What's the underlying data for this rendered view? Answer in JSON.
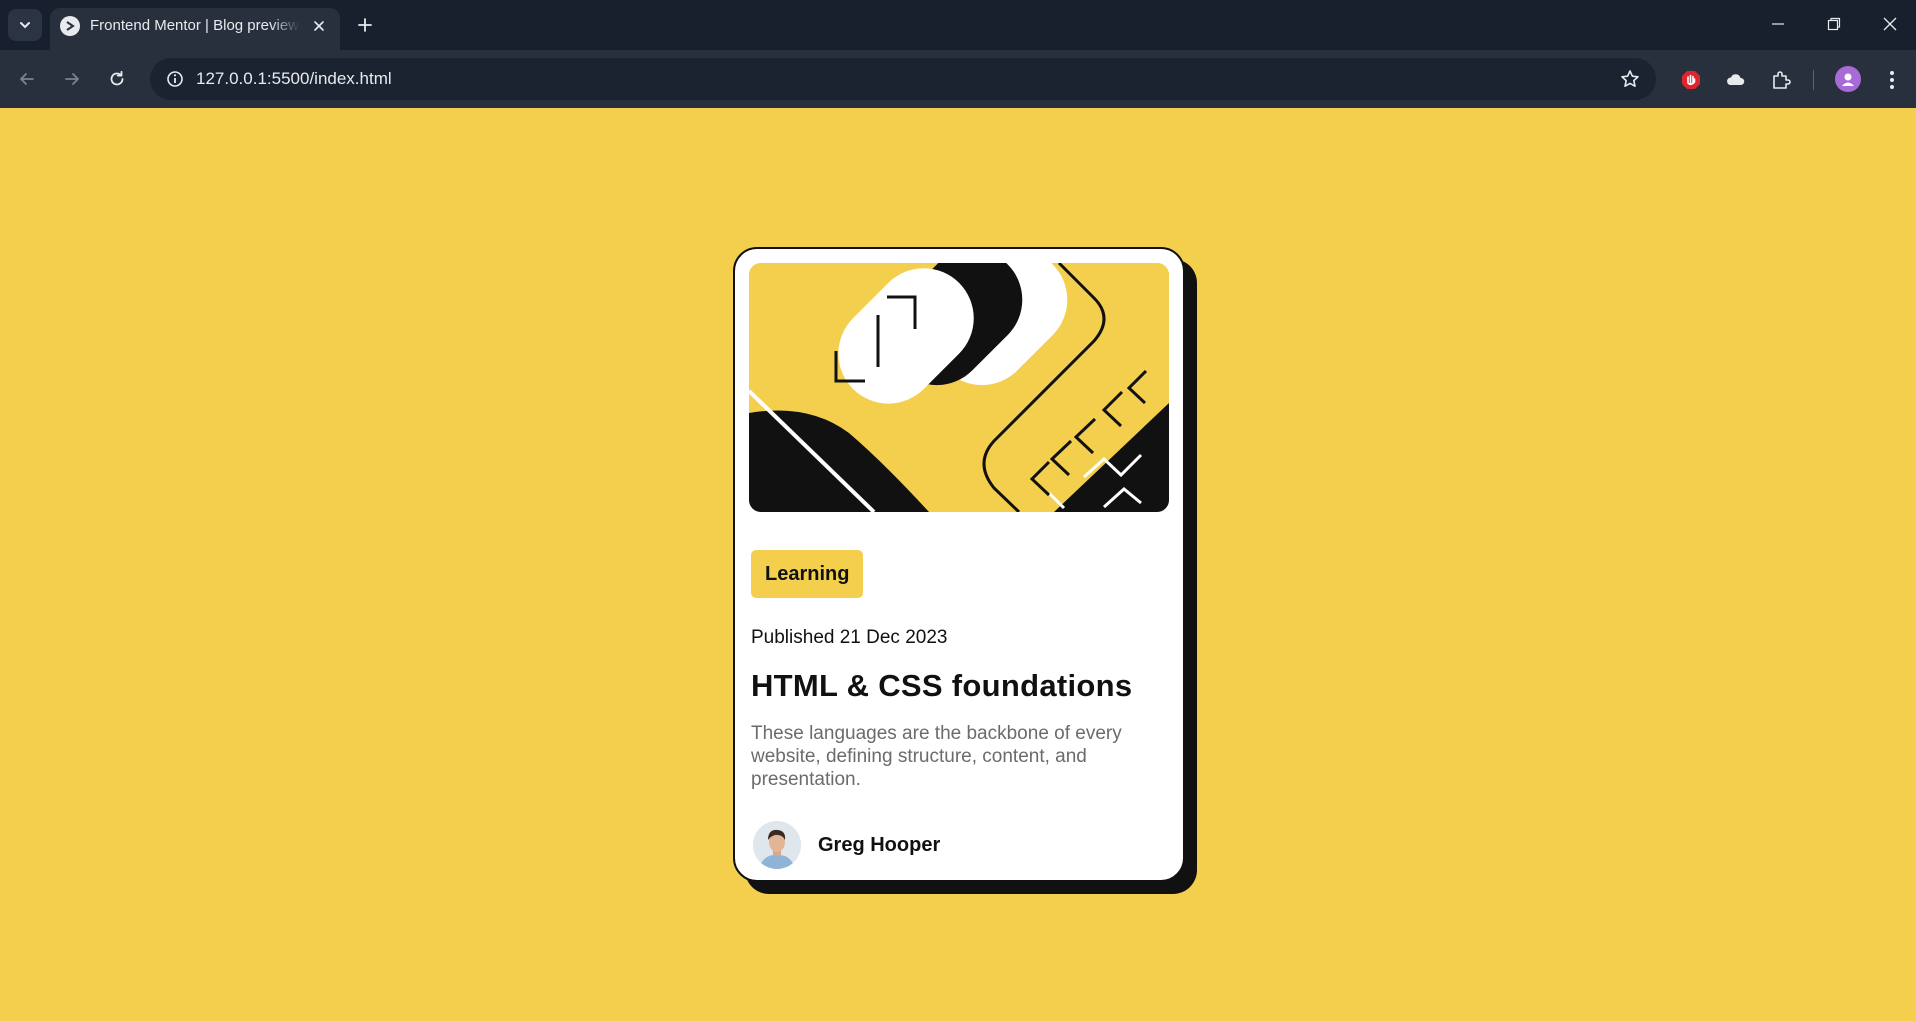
{
  "browser": {
    "tab_title": "Frontend Mentor | Blog preview card",
    "url": "127.0.0.1:5500/index.html"
  },
  "colors": {
    "page_background": "#f4cf4e",
    "card_background": "#ffffff",
    "ink": "#111111",
    "muted_text": "#6b6b6b",
    "tag_background": "#f4cf4e"
  },
  "card": {
    "tag": "Learning",
    "published": "Published 21 Dec 2023",
    "title": "HTML & CSS foundations",
    "description": "These languages are the backbone of every website, defining structure, content, and presentation.",
    "author_name": "Greg Hooper"
  }
}
